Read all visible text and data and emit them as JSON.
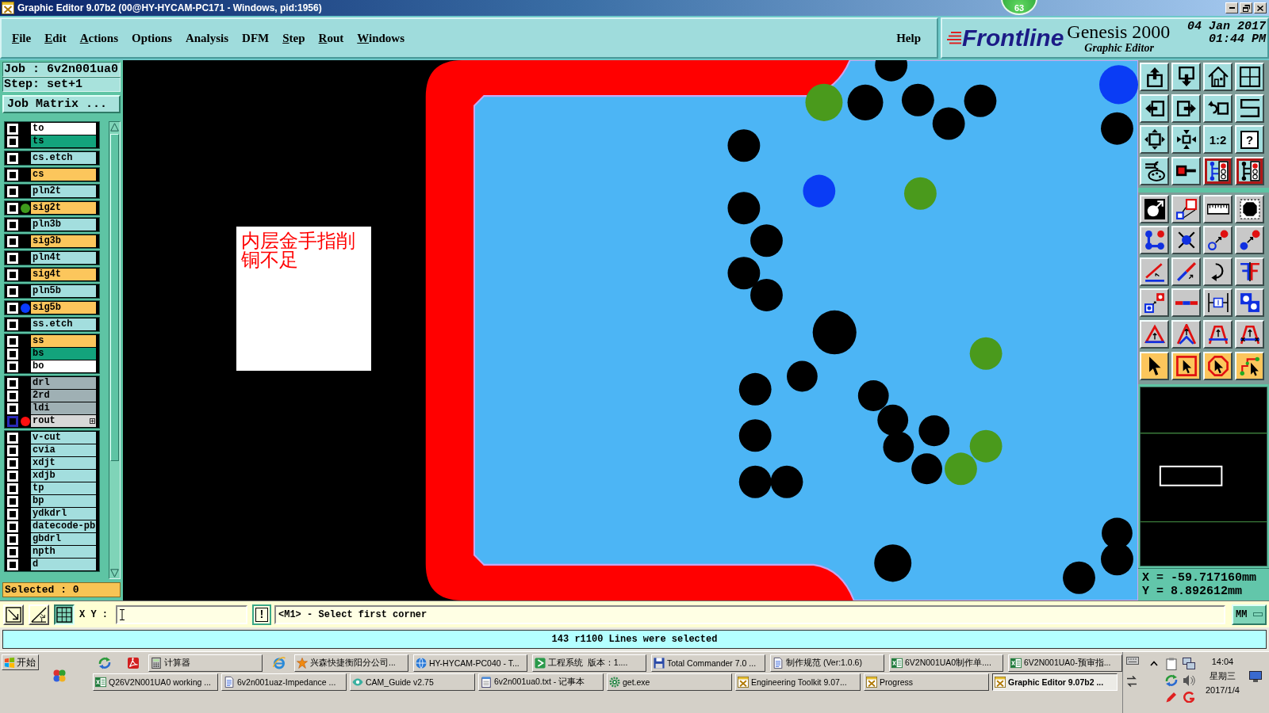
{
  "window": {
    "title": "Graphic Editor 9.07b2 (00@HY-HYCAM-PC171 - Windows, pid:1956)"
  },
  "speed_badge": "63",
  "menu": {
    "items": [
      {
        "label": "File",
        "mnemonic": true
      },
      {
        "label": "Edit",
        "mnemonic": true
      },
      {
        "label": "Actions",
        "mnemonic": true
      },
      {
        "label": "Options",
        "mnemonic": false
      },
      {
        "label": "Analysis",
        "mnemonic": false
      },
      {
        "label": "DFM",
        "mnemonic": false
      },
      {
        "label": "Step",
        "mnemonic": true
      },
      {
        "label": "Rout",
        "mnemonic": true
      },
      {
        "label": "Windows",
        "mnemonic": true
      }
    ],
    "help": {
      "label": "Help",
      "mnemonic": false
    }
  },
  "branding": {
    "logo": "Frontline",
    "product": "Genesis 2000",
    "module": "Graphic Editor",
    "date": "04 Jan 2017",
    "time": "01:44 PM"
  },
  "job_panel": {
    "job": "Job : 6v2n001ua0",
    "step": "Step: set+1",
    "matrix_button": "Job Matrix ...",
    "layer_groups": [
      {
        "rows": [
          {
            "label": "to",
            "color": "#ffffff",
            "checked": false,
            "selected": false
          },
          {
            "label": "ts",
            "color": "#13a37c",
            "checked": false,
            "selected": false
          }
        ]
      },
      {
        "rows": [
          {
            "label": "cs.etch",
            "color": "#a3dede",
            "checked": false,
            "selected": false
          }
        ]
      },
      {
        "rows": [
          {
            "label": "cs",
            "color": "#fcc65c",
            "checked": false,
            "selected": false
          }
        ]
      },
      {
        "rows": [
          {
            "label": "pln2t",
            "color": "#a3dede",
            "checked": false,
            "selected": false
          }
        ]
      },
      {
        "rows": [
          {
            "label": "sig2t",
            "color": "#fcc65c",
            "dot": {
              "color": "#3f9a1c"
            },
            "checked": false,
            "selected": false
          }
        ]
      },
      {
        "rows": [
          {
            "label": "pln3b",
            "color": "#a3dede",
            "checked": false,
            "selected": false
          }
        ]
      },
      {
        "rows": [
          {
            "label": "sig3b",
            "color": "#fcc65c",
            "checked": false,
            "selected": false
          }
        ]
      },
      {
        "rows": [
          {
            "label": "pln4t",
            "color": "#a3dede",
            "checked": false,
            "selected": false
          }
        ]
      },
      {
        "rows": [
          {
            "label": "sig4t",
            "color": "#fcc65c",
            "checked": false,
            "selected": false
          }
        ]
      },
      {
        "rows": [
          {
            "label": "pln5b",
            "color": "#a3dede",
            "checked": false,
            "selected": false
          }
        ]
      },
      {
        "rows": [
          {
            "label": "sig5b",
            "color": "#fcc65c",
            "dot": {
              "color": "#0a3cff"
            },
            "checked": false,
            "selected": false
          }
        ]
      },
      {
        "rows": [
          {
            "label": "ss.etch",
            "color": "#a3dede",
            "checked": false,
            "selected": false
          }
        ]
      },
      {
        "rows": [
          {
            "label": "ss",
            "color": "#fcc65c",
            "checked": false,
            "selected": false
          },
          {
            "label": "bs",
            "color": "#13a37c",
            "checked": false,
            "selected": false
          },
          {
            "label": "bo",
            "color": "#ffffff",
            "checked": false,
            "selected": false
          }
        ]
      },
      {
        "rows": [
          {
            "label": "drl",
            "color": "#9fb0b4",
            "checked": false,
            "selected": false
          },
          {
            "label": "2rd",
            "color": "#9fb0b4",
            "checked": false,
            "selected": false
          },
          {
            "label": "ldi",
            "color": "#9fb0b4",
            "checked": false,
            "selected": false
          },
          {
            "label": "rout",
            "color": "#d8d8d8",
            "dot": {
              "color": "#ff1010"
            },
            "checked": false,
            "selected": true
          }
        ]
      },
      {
        "rows": [
          {
            "label": "v-cut",
            "color": "#a3dede",
            "checked": false,
            "selected": false
          },
          {
            "label": "cvia",
            "color": "#a3dede",
            "checked": false,
            "selected": false
          },
          {
            "label": "xdjt",
            "color": "#a3dede",
            "checked": false,
            "selected": false
          },
          {
            "label": "xdjb",
            "color": "#a3dede",
            "checked": false,
            "selected": false
          },
          {
            "label": "tp",
            "color": "#a3dede",
            "checked": false,
            "selected": false
          },
          {
            "label": "bp",
            "color": "#a3dede",
            "checked": false,
            "selected": false
          },
          {
            "label": "ydkdrl",
            "color": "#a3dede",
            "checked": false,
            "selected": false
          },
          {
            "label": "datecode-pb",
            "color": "#a3dede",
            "checked": false,
            "selected": false
          },
          {
            "label": "gbdrl",
            "color": "#a3dede",
            "checked": false,
            "selected": false
          },
          {
            "label": "npth",
            "color": "#a3dede",
            "checked": false,
            "selected": false
          },
          {
            "label": "d",
            "color": "#a3dede",
            "checked": false,
            "selected": false
          }
        ]
      }
    ],
    "selected_count": "Selected : 0"
  },
  "canvas": {
    "note": "内层金手指削铜不足"
  },
  "tool_palette": {
    "sections": [
      {
        "color": "#a3dede",
        "buttons": [
          {
            "kind": "boxup",
            "on": false
          },
          {
            "kind": "boxdown",
            "on": false
          },
          {
            "kind": "home",
            "on": false
          },
          {
            "kind": "grid",
            "on": false
          },
          {
            "kind": "boxleft",
            "on": false
          },
          {
            "kind": "boxright",
            "on": false
          },
          {
            "kind": "undo",
            "on": false
          },
          {
            "kind": "zigzag",
            "on": false
          },
          {
            "kind": "expand",
            "on": false
          },
          {
            "kind": "shrink",
            "on": false
          },
          {
            "kind": "text",
            "label": "1:2",
            "on": false
          },
          {
            "kind": "framedtext",
            "label": "?",
            "on": false
          },
          {
            "kind": "tools",
            "on": false
          },
          {
            "kind": "probe",
            "on": false
          },
          {
            "kind": "circuit",
            "on": true
          },
          {
            "kind": "circuitb",
            "on": true
          }
        ]
      },
      {
        "color": "#c8c8c8",
        "buttons": [
          {
            "kind": "circlearrow",
            "on": false
          },
          {
            "kind": "polygons",
            "on": false
          },
          {
            "kind": "ruler",
            "on": false
          },
          {
            "kind": "octagon",
            "on": false
          },
          {
            "kind": "dotsl",
            "on": false
          },
          {
            "kind": "crossdot",
            "on": false
          },
          {
            "kind": "dotarrowring",
            "on": false
          },
          {
            "kind": "dotarrow",
            "on": false
          },
          {
            "kind": "anglelines",
            "on": false
          },
          {
            "kind": "linearrow",
            "on": false
          },
          {
            "kind": "rotate",
            "on": false
          },
          {
            "kind": "mirror",
            "on": false
          },
          {
            "kind": "squaresarrow",
            "on": false
          },
          {
            "kind": "segment",
            "on": false
          },
          {
            "kind": "dimension",
            "on": false
          },
          {
            "kind": "circlessquare",
            "on": false
          },
          {
            "kind": "triangle",
            "on": false
          },
          {
            "kind": "peak",
            "on": false
          },
          {
            "kind": "arch",
            "on": false
          },
          {
            "kind": "archcross",
            "on": false
          }
        ]
      },
      {
        "color": "#fcc65c",
        "buttons": [
          {
            "kind": "pointer",
            "on": false
          },
          {
            "kind": "pointerbox",
            "on": false
          },
          {
            "kind": "pointeroct",
            "on": false
          },
          {
            "kind": "pointerroute",
            "on": false
          }
        ]
      }
    ]
  },
  "coordinates": {
    "x": "X = -59.717160mm",
    "y": "Y = 8.892612mm"
  },
  "command_bar": {
    "tools": [
      {
        "kind": "diagonal",
        "on": false
      },
      {
        "kind": "angle",
        "on": false
      },
      {
        "kind": "gridsnap",
        "on": true
      }
    ],
    "xy_label": "X Y :",
    "alert_button": "!",
    "prompt": "<M1> - Select first corner",
    "units": "MM"
  },
  "status_bar": {
    "message": "143 r1100 Lines were selected"
  },
  "taskbar": {
    "start": "开始",
    "task_rows": [
      {
        "items": [
          {
            "kind": "swirl"
          },
          {
            "kind": "pdf"
          },
          {
            "kind": "calculator",
            "label": "计算器",
            "selected": false
          },
          {
            "kind": "browser"
          },
          {
            "kind": "star",
            "label": "兴森快捷衡阳分公司...",
            "selected": false
          },
          {
            "kind": "globe",
            "label": "HY-HYCAM-PC040 - T...",
            "selected": false
          },
          {
            "kind": "tile",
            "label": "工程系统  版本：1....",
            "selected": false
          },
          {
            "kind": "disk",
            "label": "Total Commander 7.0 ...",
            "selected": false
          },
          {
            "kind": "document",
            "label": "制作规范 (Ver:1.0.6)",
            "selected": false
          },
          {
            "kind": "sheet",
            "label": "6V2N001UA0制作单....",
            "selected": false
          },
          {
            "kind": "sheet",
            "label": "6V2N001UA0-预审指...",
            "selected": false
          }
        ]
      },
      {
        "items": [
          {
            "kind": "sheet",
            "label": "Q26V2N001UA0 working ...",
            "selected": false
          },
          {
            "kind": "document",
            "label": "6v2n001uaz-Impedance ...",
            "selected": false
          },
          {
            "kind": "eye",
            "label": "CAM_Guide v2.75",
            "selected": false
          },
          {
            "kind": "notepad",
            "label": "6v2n001ua0.txt - 记事本",
            "selected": false
          },
          {
            "kind": "gear",
            "label": "get.exe",
            "selected": false
          },
          {
            "kind": "xwindow",
            "label": "Engineering Toolkit 9.07...",
            "selected": false
          },
          {
            "kind": "xwindow",
            "label": "Progress",
            "selected": false
          },
          {
            "kind": "xwindow",
            "label": "Graphic Editor 9.07b2 ...",
            "selected": true
          }
        ]
      }
    ],
    "tray": {
      "time": "14:04",
      "weekday": "星期三",
      "date": "2017/1/4"
    }
  }
}
